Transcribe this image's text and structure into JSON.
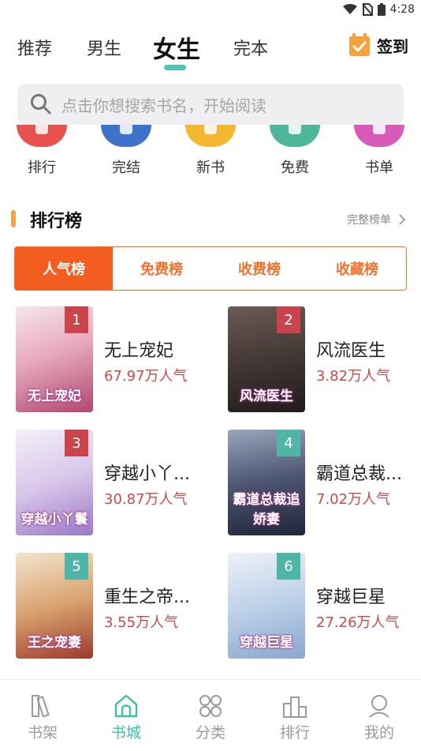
{
  "status": {
    "time": "4:28"
  },
  "top_tabs": [
    "推荐",
    "男生",
    "女生",
    "完本"
  ],
  "checkin_label": "签到",
  "search": {
    "placeholder": "点击你想搜索书名，开始阅读"
  },
  "quick_nav": [
    {
      "label": "排行",
      "color": "#e8524e"
    },
    {
      "label": "完结",
      "color": "#3f72c9"
    },
    {
      "label": "新书",
      "color": "#f4b731"
    },
    {
      "label": "免费",
      "color": "#4fb69b"
    },
    {
      "label": "书单",
      "color": "#d85ab8"
    }
  ],
  "ranking": {
    "title": "排行榜",
    "more": "完整榜单",
    "tabs": [
      "人气榜",
      "免费榜",
      "收费榜",
      "收藏榜"
    ]
  },
  "books": [
    {
      "rank": "1",
      "title": "无上宠妃",
      "popularity": "67.97万人气",
      "cover_text": "无上宠妃",
      "tag_color": "#c9454b"
    },
    {
      "rank": "2",
      "title": "风流医生",
      "popularity": "3.82万人气",
      "cover_text": "风流医生",
      "tag_color": "#c9454b"
    },
    {
      "rank": "3",
      "title": "穿越小丫...",
      "popularity": "30.87万人气",
      "cover_text": "穿越小丫鬟",
      "tag_color": "#c9454b"
    },
    {
      "rank": "4",
      "title": "霸道总裁...",
      "popularity": "7.02万人气",
      "cover_text": "霸道总裁追娇妻",
      "tag_color": "#4fb6a7"
    },
    {
      "rank": "5",
      "title": "重生之帝...",
      "popularity": "3.55万人气",
      "cover_text": "王之宠妻",
      "tag_color": "#4fb6a7"
    },
    {
      "rank": "6",
      "title": "穿越巨星",
      "popularity": "27.26万人气",
      "cover_text": "穿越巨星",
      "tag_color": "#4fb6a7"
    }
  ],
  "bottom_nav": [
    "书架",
    "书城",
    "分类",
    "排行",
    "我的"
  ]
}
